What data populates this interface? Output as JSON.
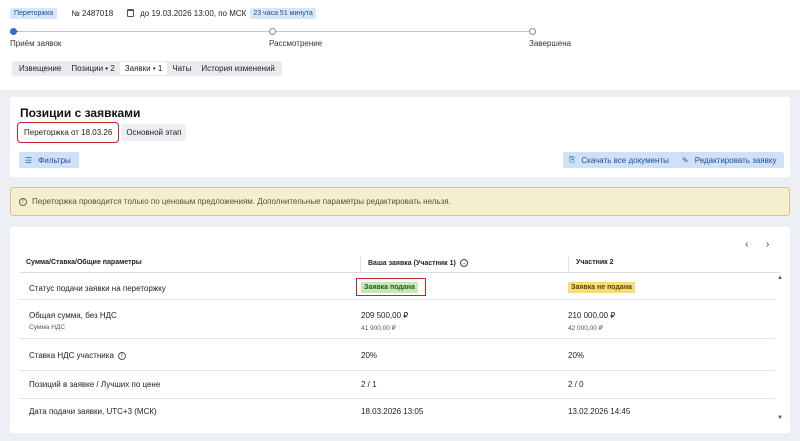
{
  "header": {
    "type_badge": "Переторжка",
    "number": "№ 2487018",
    "deadline": "до 19.03.2026 13:00, по МСК",
    "time_left": "23 часа 51 минута"
  },
  "progress": {
    "steps": [
      {
        "label": "Приём заявок",
        "state": "active"
      },
      {
        "label": "Рассмотрение",
        "state": "pending"
      },
      {
        "label": "Завершена",
        "state": "pending"
      }
    ]
  },
  "tabs": [
    {
      "label": "Извещение"
    },
    {
      "label": "Позиции • 2"
    },
    {
      "label": "Заявки • 1",
      "active": true
    },
    {
      "label": "Чаты"
    },
    {
      "label": "История изменений"
    }
  ],
  "positions_panel": {
    "title": "Позиции с заявками",
    "stages": [
      {
        "label": "Переторжка от 18.03.26",
        "selected": true
      },
      {
        "label": "Основной этап"
      }
    ],
    "filters_label": "Фильтры",
    "download_label": "Скачать все документы",
    "edit_label": "Редактировать заявку"
  },
  "alert": {
    "text": "Переторжка проводится только по ценовым предложениям. Дополнительные параметры редактировать нельзя."
  },
  "table": {
    "headers": {
      "param": "Сумма/Ставка/Общие параметры",
      "own": "Ваша заявка (Участник 1)",
      "other": "Участник 2"
    },
    "rows": {
      "status": {
        "label": "Статус подачи заявки на переторжку",
        "own": "Заявка подана",
        "other": "Заявка не подана"
      },
      "sum": {
        "label": "Общая сумма, без НДС",
        "sublabel": "Сумма НДС",
        "own": "209 500,00 ₽",
        "own_sub": "41 900,00 ₽",
        "other": "210 000,00 ₽",
        "other_sub": "42 000,00 ₽"
      },
      "vat": {
        "label": "Ставка НДС участника",
        "own": "20%",
        "other": "20%"
      },
      "positions": {
        "label": "Позиций в заявке / Лучших по цене",
        "own": "2 / 1",
        "other": "2 / 0"
      },
      "date": {
        "label": "Дата подачи заявки, UTC+3 (МСК)",
        "own": "18.03.2026 13:05",
        "other": "13.02.2026 14:45"
      }
    }
  },
  "colors": {
    "accent": "#2b6fd6",
    "highlight": "#c1272d",
    "status_submitted": "#c8e6b8",
    "status_not_submitted": "#f8dc7c",
    "alert_bg": "#f5efcf"
  }
}
